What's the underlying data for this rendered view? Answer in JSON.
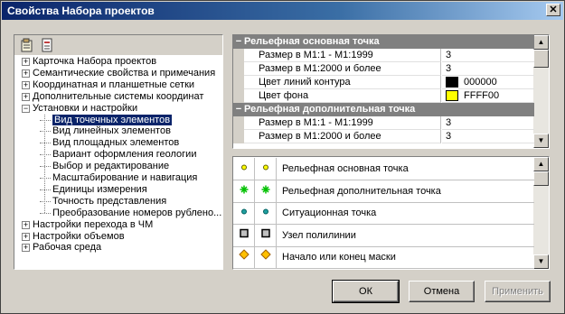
{
  "window": {
    "title": "Свойства Набора проектов"
  },
  "icons": {
    "close": "✕"
  },
  "tree": {
    "nodes": [
      {
        "label": "Карточка Набора проектов",
        "expander": "+"
      },
      {
        "label": "Семантические свойства и примечания",
        "expander": "+"
      },
      {
        "label": "Координатная и планшетные сетки",
        "expander": "+"
      },
      {
        "label": "Дополнительные системы координат",
        "expander": "+"
      },
      {
        "label": "Установки и настройки",
        "expander": "−"
      },
      {
        "label": "Вид точечных элементов",
        "selected": true
      },
      {
        "label": "Вид линейных элементов"
      },
      {
        "label": "Вид площадных элементов"
      },
      {
        "label": "Вариант оформления геологии"
      },
      {
        "label": "Выбор и редактирование"
      },
      {
        "label": "Масштабирование и навигация"
      },
      {
        "label": "Единицы измерения"
      },
      {
        "label": "Точность представления"
      },
      {
        "label": "Преобразование номеров рублено..."
      },
      {
        "label": "Настройки перехода в ЧМ",
        "expander": "+"
      },
      {
        "label": "Настройки объемов",
        "expander": "+"
      },
      {
        "label": "Рабочая среда",
        "expander": "+"
      }
    ]
  },
  "properties": {
    "groups": [
      {
        "header": "Рельефная основная точка",
        "rows": [
          {
            "name": "Размер в М1:1 - М1:1999",
            "value": "3"
          },
          {
            "name": "Размер в М1:2000 и более",
            "value": "3"
          },
          {
            "name": "Цвет линий контура",
            "value": "000000",
            "color": "#000000"
          },
          {
            "name": "Цвет фона",
            "value": "FFFF00",
            "color": "#ffff00"
          }
        ]
      },
      {
        "header": "Рельефная дополнительная точка",
        "rows": [
          {
            "name": "Размер в М1:1 - М1:1999",
            "value": "3"
          },
          {
            "name": "Размер в М1:2000 и более",
            "value": "3"
          }
        ]
      }
    ]
  },
  "elements": {
    "rows": [
      {
        "label": "Рельефная основная точка",
        "symbol": "small-yellow-dot-icon"
      },
      {
        "label": "Рельефная дополнительная точка",
        "symbol": "green-asterisk-icon"
      },
      {
        "label": "Ситуационная точка",
        "symbol": "teal-dot-icon"
      },
      {
        "label": "Узел полилинии",
        "symbol": "square-node-icon"
      },
      {
        "label": "Начало или конец маски",
        "symbol": "diamond-icon"
      }
    ]
  },
  "buttons": {
    "ok": "ОК",
    "cancel": "Отмена",
    "apply": "Применить"
  },
  "colors": {
    "titlebar_start": "#0a246a",
    "selection": "#0a246a",
    "category_header": "#808080"
  }
}
